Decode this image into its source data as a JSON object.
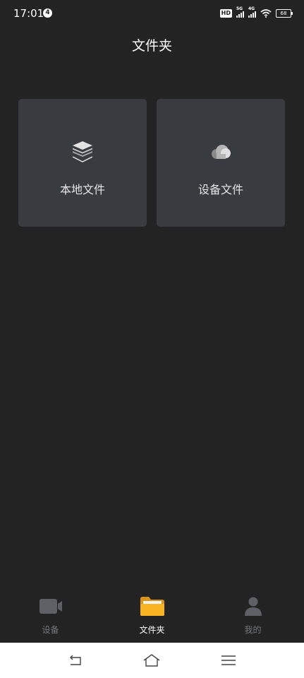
{
  "status_bar": {
    "time": "17:01",
    "notification_count": "4",
    "hd_label": "HD",
    "network_5g": "5G",
    "network_4g": "4G",
    "battery": "68"
  },
  "header": {
    "title": "文件夹"
  },
  "cards": [
    {
      "label": "本地文件",
      "icon": "layers-stack-icon"
    },
    {
      "label": "设备文件",
      "icon": "cloud-icon"
    }
  ],
  "tabs": [
    {
      "label": "设备",
      "icon": "video-camera-icon",
      "active": false
    },
    {
      "label": "文件夹",
      "icon": "folder-icon",
      "active": true
    },
    {
      "label": "我的",
      "icon": "person-icon",
      "active": false
    }
  ],
  "colors": {
    "background": "#232323",
    "card": "#383b3f",
    "active_tab_icon": "#f9b424",
    "inactive_tab": "#75777b"
  }
}
